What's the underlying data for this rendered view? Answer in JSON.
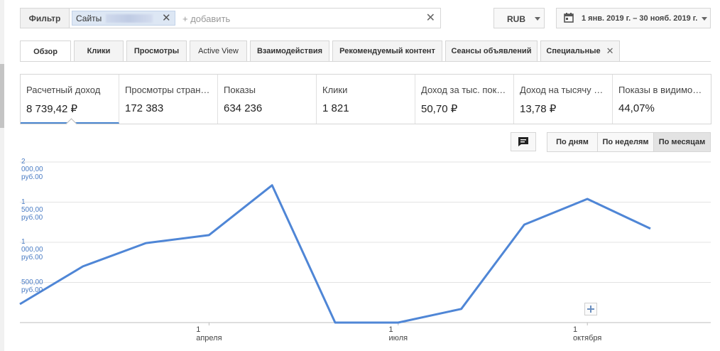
{
  "filter": {
    "button_label": "Фильтр",
    "chip_label": "Сайты",
    "chip_remove_glyph": "✕",
    "add_placeholder": "+ добавить",
    "clear_glyph": "✕"
  },
  "currency": {
    "value": "RUB"
  },
  "date_range": {
    "value": "1 янв. 2019 г. – 30 нояб. 2019 г."
  },
  "tabs": [
    {
      "label": "Обзор",
      "active": true
    },
    {
      "label": "Клики"
    },
    {
      "label": "Просмотры"
    },
    {
      "label": "Active View"
    },
    {
      "label": "Взаимодействия"
    },
    {
      "label": "Рекомендуемый контент"
    },
    {
      "label": "Сеансы объявлений"
    },
    {
      "label": "Специальные",
      "close_glyph": "✕"
    }
  ],
  "metrics": [
    {
      "label": "Расчетный доход",
      "value": "8 739,42 ₽"
    },
    {
      "label": "Просмотры стран…",
      "value": "172 383"
    },
    {
      "label": "Показы",
      "value": "634 236"
    },
    {
      "label": "Клики",
      "value": "1 821"
    },
    {
      "label": "Доход за тыс. пок…",
      "value": "50,70 ₽"
    },
    {
      "label": "Доход на тысячу …",
      "value": "13,78 ₽"
    },
    {
      "label": "Показы в видимо…",
      "value": "44,07%"
    }
  ],
  "period_buttons": [
    {
      "label": "По дням"
    },
    {
      "label": "По неделям"
    },
    {
      "label": "По месяцам",
      "active": true
    }
  ],
  "colors": {
    "accent": "#4a86cf",
    "line": "#4f86d6",
    "axis_label": "#4a7cc4",
    "grid": "#e3e3e3"
  },
  "icons": {
    "comment": "comment-icon",
    "calendar": "calendar-icon",
    "plus": "plus-icon"
  },
  "chart_data": {
    "type": "line",
    "ylim": [
      0,
      2000
    ],
    "y_ticks": [
      {
        "value": 2000,
        "label": "2 000,00 руб.00"
      },
      {
        "value": 1500,
        "label": "1 500,00 руб.00"
      },
      {
        "value": 1000,
        "label": "1 000,00 руб.00"
      },
      {
        "value": 500,
        "label": "500,00 руб.00"
      }
    ],
    "x_ticks": [
      {
        "index": 3,
        "label": "1 апреля"
      },
      {
        "index": 6,
        "label": "1 июля"
      },
      {
        "index": 9,
        "label": "1 октября"
      }
    ],
    "points": [
      {
        "i": 0,
        "y": 230
      },
      {
        "i": 1,
        "y": 700
      },
      {
        "i": 2,
        "y": 990
      },
      {
        "i": 3,
        "y": 1090
      },
      {
        "i": 4,
        "y": 1710
      },
      {
        "i": 5,
        "y": 0
      },
      {
        "i": 6,
        "y": 0
      },
      {
        "i": 7,
        "y": 170
      },
      {
        "i": 8,
        "y": 1220
      },
      {
        "i": 9,
        "y": 1540
      },
      {
        "i": 10,
        "y": 1170
      }
    ],
    "grid": true
  }
}
